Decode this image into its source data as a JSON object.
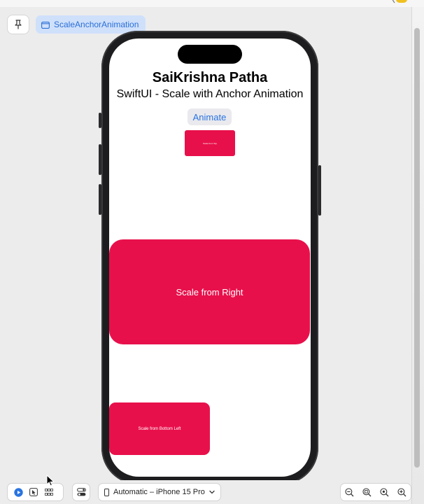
{
  "toolbar": {
    "pin_icon": "pin-icon",
    "preview_tab_label": "ScaleAnchorAnimation",
    "preview_tab_icon": "window-icon"
  },
  "app": {
    "title": "SaiKrishna Patha",
    "subtitle": "SwiftUI - Scale with Anchor Animation",
    "animate_button": "Animate",
    "cards": {
      "small_label": "Scale from Top",
      "big_label": "Scale from Right",
      "bottom_left_label": "Scale from Bottom Left"
    },
    "accent": "#e8104b"
  },
  "bottom_bar": {
    "live_icon": "play-icon",
    "selectable_icon": "cursor-select-icon",
    "variants_icon": "grid-icon",
    "settings_icon": "device-settings-icon",
    "device_label": "Automatic – iPhone 15 Pro",
    "zoom_icons": [
      "zoom-out-icon",
      "zoom-fit-icon",
      "zoom-actual-icon",
      "zoom-in-icon"
    ]
  }
}
